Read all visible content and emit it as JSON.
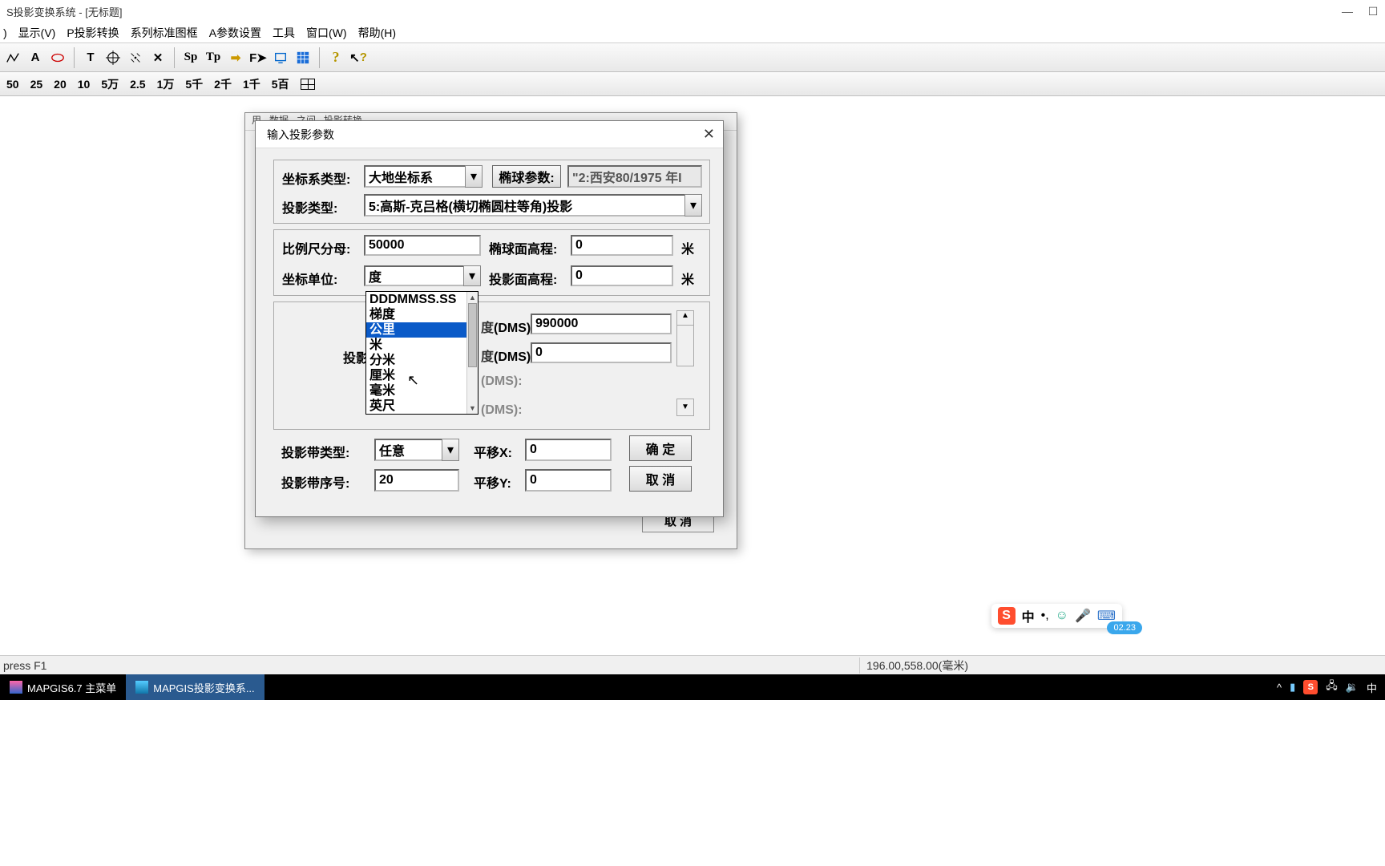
{
  "window": {
    "title": "S投影变换系统 - [无标题]"
  },
  "menu": {
    "items": [
      "显示(V)",
      "P投影转换",
      "系列标准图框",
      "A参数设置",
      "工具",
      "窗口(W)",
      "帮助(H)"
    ],
    "left_fragment": ")"
  },
  "toolbar": {
    "icons": [
      "line",
      "text-a",
      "oval",
      "sep",
      "vline-t",
      "target",
      "scatter",
      "x",
      "sep",
      "sp",
      "tp",
      "arrow-r",
      "f-arrow",
      "monitor",
      "grid-blue",
      "sep",
      "help-q",
      "help-arrow"
    ]
  },
  "scalebar": {
    "items": [
      "50",
      "25",
      "20",
      "10",
      "5万",
      "2.5",
      "1万",
      "5千",
      "2千",
      "1千",
      "5百"
    ]
  },
  "outer_dialog": {
    "title_fragment": "用...数据...之间...投影转换",
    "cancel": "取 消"
  },
  "dialog": {
    "title": "输入投影参数",
    "coord_sys_type_label": "坐标系类型:",
    "coord_sys_type_value": "大地坐标系",
    "ellipsoid_btn": "椭球参数:",
    "ellipsoid_value": "\"2:西安80/1975 年I",
    "proj_type_label": "投影类型:",
    "proj_type_value": "5:高斯-克吕格(横切椭圆柱等角)投影",
    "scale_denom_label": "比例尺分母:",
    "scale_denom_value": "50000",
    "ellipsoid_height_label": "椭球面高程:",
    "ellipsoid_height_value": "0",
    "ellipsoid_height_unit": "米",
    "coord_unit_label": "坐标单位:",
    "coord_unit_value": "度",
    "proj_height_label": "投影面高程:",
    "proj_height_value": "0",
    "proj_height_unit": "米",
    "proj_section_label": "投影",
    "dms1_suffix": "(DMS)",
    "dms1_value": "990000",
    "dms2_suffix": "(DMS)",
    "dms2_value": "0",
    "dms3_suffix": "(DMS):",
    "dms4_suffix": "(DMS):",
    "zone_type_label": "投影带类型:",
    "zone_type_value": "任意",
    "shift_x_label": "平移X:",
    "shift_x_value": "0",
    "zone_no_label": "投影带序号:",
    "zone_no_value": "20",
    "shift_y_label": "平移Y:",
    "shift_y_value": "0",
    "ok_btn": "确 定",
    "cancel_btn": "取 消"
  },
  "dropdown": {
    "items": [
      "DDDMMSS.SS",
      "梯度",
      "公里",
      "米",
      "分米",
      "厘米",
      "毫米",
      "英尺"
    ],
    "selected_index": 2
  },
  "ime": {
    "logo": "S",
    "mode": "中",
    "badge": "02.23"
  },
  "statusbar": {
    "left": "press F1",
    "coords": "196.00,558.00(毫米)"
  },
  "taskbar": {
    "item1": "MAPGIS6.7 主菜单",
    "item2": "MAPGIS投影变换系...",
    "tray_mode": "中"
  }
}
